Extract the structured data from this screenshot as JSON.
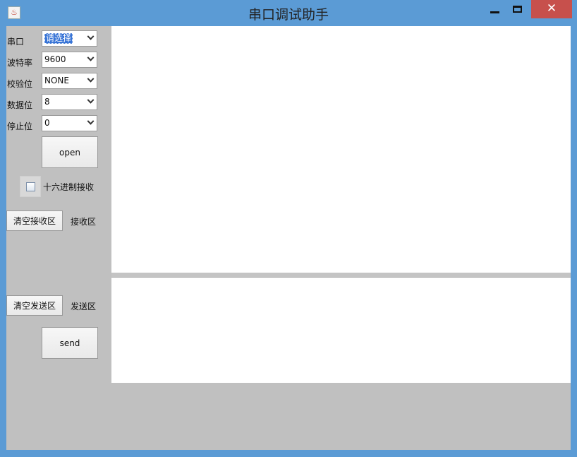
{
  "window": {
    "title": "串口调试助手",
    "close_glyph": "✕"
  },
  "form": {
    "port": {
      "label": "串口",
      "value": "请选择"
    },
    "baud": {
      "label": "波特率",
      "value": "9600"
    },
    "parity": {
      "label": "校验位",
      "value": "NONE"
    },
    "databits": {
      "label": "数据位",
      "value": "8"
    },
    "stopbits": {
      "label": "停止位",
      "value": "0"
    },
    "open_label": "open",
    "hex_receive_label": "十六进制接收"
  },
  "receive": {
    "clear_label": "清空接收区",
    "area_label": "接收区"
  },
  "send": {
    "clear_label": "清空发送区",
    "area_label": "发送区",
    "send_label": "send"
  },
  "colors": {
    "frame": "#5b9bd5",
    "close": "#c7504c",
    "panel": "#c0c0c0",
    "selection": "#3874d6"
  }
}
